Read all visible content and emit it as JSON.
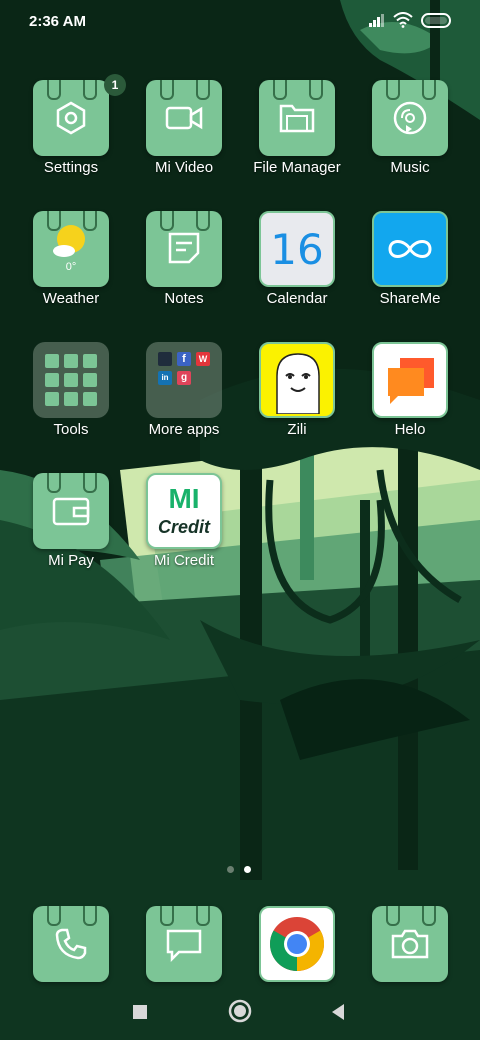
{
  "status": {
    "time": "2:36 AM"
  },
  "apps": [
    {
      "name": "settings",
      "label": "Settings",
      "badge": "1"
    },
    {
      "name": "mi-video",
      "label": "Mi Video"
    },
    {
      "name": "file-manager",
      "label": "File Manager"
    },
    {
      "name": "music",
      "label": "Music"
    },
    {
      "name": "weather",
      "label": "Weather",
      "temp": "0°"
    },
    {
      "name": "notes",
      "label": "Notes"
    },
    {
      "name": "calendar",
      "label": "Calendar",
      "date": "16"
    },
    {
      "name": "shareme",
      "label": "ShareMe"
    },
    {
      "name": "tools",
      "label": "Tools"
    },
    {
      "name": "more-apps",
      "label": "More apps"
    },
    {
      "name": "zili",
      "label": "Zili"
    },
    {
      "name": "helo",
      "label": "Helo"
    },
    {
      "name": "mi-pay",
      "label": "Mi Pay"
    },
    {
      "name": "mi-credit",
      "label": "Mi Credit",
      "logo_line1": "MI",
      "logo_line2": "Credit"
    }
  ],
  "more_apps_tiles": [
    "f",
    "W",
    "in",
    "g"
  ],
  "dock": [
    {
      "name": "phone",
      "icon": "phone-icon"
    },
    {
      "name": "messages",
      "icon": "message-icon"
    },
    {
      "name": "chrome",
      "icon": "chrome-icon"
    },
    {
      "name": "camera",
      "icon": "camera-icon"
    }
  ],
  "pager": {
    "pages": 2,
    "active": 2
  },
  "colors": {
    "tile": "#7cc596",
    "wallpaper_dark": "#0b2a18",
    "wallpaper_light": "#d9efb8"
  }
}
